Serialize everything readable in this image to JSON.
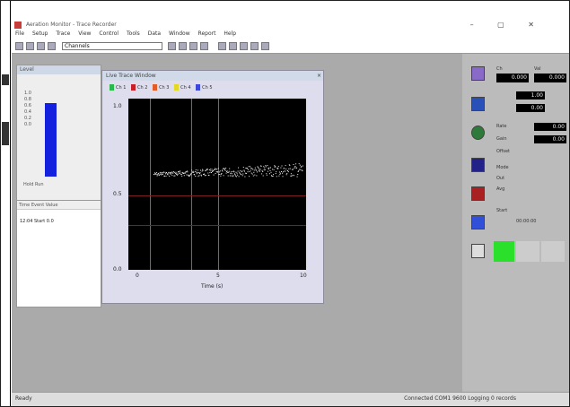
{
  "app": {
    "title": "Aeration Monitor - Trace Recorder",
    "window_controls": "– ▢ ✕"
  },
  "menu": [
    "File",
    "Setup",
    "Trace",
    "View",
    "Control",
    "Tools",
    "Data",
    "Window",
    "Report",
    "Help"
  ],
  "toolbar": {
    "config_value": "Channels"
  },
  "meter_window": {
    "title": "Level",
    "scale": "1.0\n0.8\n0.6\n0.4\n0.2\n0.0",
    "controls": "Hold Run"
  },
  "log_window": {
    "header": "Time   Event   Value",
    "row": "12:04  Start  0.0"
  },
  "trace_window": {
    "title": "Live Trace Window",
    "close": "×",
    "legend": [
      "Ch 1",
      "Ch 2",
      "Ch 3",
      "Ch 4",
      "Ch 5"
    ],
    "legend_colors": [
      "#2ab84a",
      "#c8202a",
      "#e25c28",
      "#e2d828",
      "#3c48d8"
    ],
    "y_ticks": [
      "1.0",
      "0.5",
      "0.0"
    ],
    "x_ticks": [
      "0",
      "5",
      "10"
    ],
    "xlabel": "Time (s)"
  },
  "right_panel": {
    "top_labels": [
      "Ch",
      "Val"
    ],
    "readouts": [
      "0.000",
      "0.000",
      "1.00",
      "0.00",
      "0.00",
      "0.00"
    ],
    "field_labels": [
      "Rate",
      "Gain",
      "Offset",
      "Mode",
      "Out",
      "Avg"
    ],
    "lower_label": "Start",
    "lower_value": "00:00:00",
    "icons": [
      "record-icon",
      "save-icon",
      "globe-icon",
      "stop-icon",
      "alarm-icon",
      "chart-icon",
      "help-icon"
    ]
  },
  "statusbar": {
    "ready": "Ready",
    "right": "Connected  COM1  9600  Logging  0 records"
  }
}
